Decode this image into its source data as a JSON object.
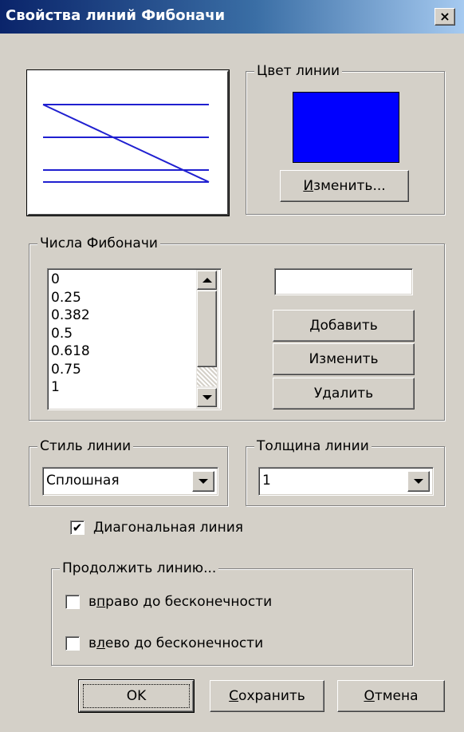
{
  "window": {
    "title": "Свойства линий Фибоначи",
    "close_glyph": "×"
  },
  "colors": {
    "line_color": "#0000ff",
    "preview_line": "#2020d0"
  },
  "line_color_group": {
    "label": "Цвет линии",
    "change_button": {
      "prefix": "",
      "mnemonic": "И",
      "rest": "зменить..."
    }
  },
  "fib_group": {
    "label": "Числа Фибоначи",
    "items": [
      "0",
      "0.25",
      "0.382",
      "0.5",
      "0.618",
      "0.75",
      "1"
    ],
    "value_input": "",
    "add_button": "Добавить",
    "edit_button": "Изменить",
    "delete_button": "Удалить"
  },
  "line_style_group": {
    "label": "Стиль линии",
    "selected": "Сплошная"
  },
  "line_width_group": {
    "label": "Толщина линии",
    "selected": "1"
  },
  "diagonal_checkbox": {
    "checked": true,
    "check_glyph": "✔",
    "label": {
      "prefix": "",
      "mnemonic": "Д",
      "rest": "иагональная линия"
    }
  },
  "extend_group": {
    "label": "Продолжить линию...",
    "right": {
      "checked": false,
      "prefix": "в",
      "mnemonic": "п",
      "rest": "раво до бесконечности"
    },
    "left": {
      "checked": false,
      "prefix": "в",
      "mnemonic": "л",
      "rest": "ево до бесконечности"
    }
  },
  "footer": {
    "ok": "OK",
    "save": {
      "prefix": "",
      "mnemonic": "С",
      "rest": "охранить"
    },
    "cancel": {
      "prefix": "",
      "mnemonic": "О",
      "rest": "тмена"
    }
  }
}
